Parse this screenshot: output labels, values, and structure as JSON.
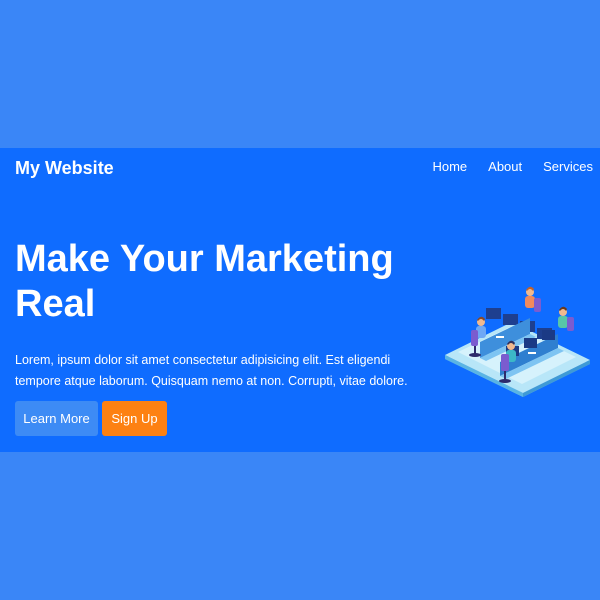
{
  "navbar": {
    "brand": "My Website",
    "links": [
      {
        "label": "Home"
      },
      {
        "label": "About"
      },
      {
        "label": "Services"
      }
    ]
  },
  "hero": {
    "title": "Make Your Marketing Real",
    "text": "Lorem, ipsum dolor sit amet consectetur adipisicing elit. Est eligendi tempore atque laborum. Quisquam nemo at non. Corrupti, vitae dolore.",
    "buttons": {
      "learn_more": "Learn More",
      "sign_up": "Sign Up"
    },
    "illustration": "isometric-office-team-illustration"
  },
  "colors": {
    "page_background": "#3a86f7",
    "banner_background": "#0f6cff",
    "learn_more_button": "#3d8bf5",
    "sign_up_button": "#fd8112",
    "text": "#ffffff"
  }
}
